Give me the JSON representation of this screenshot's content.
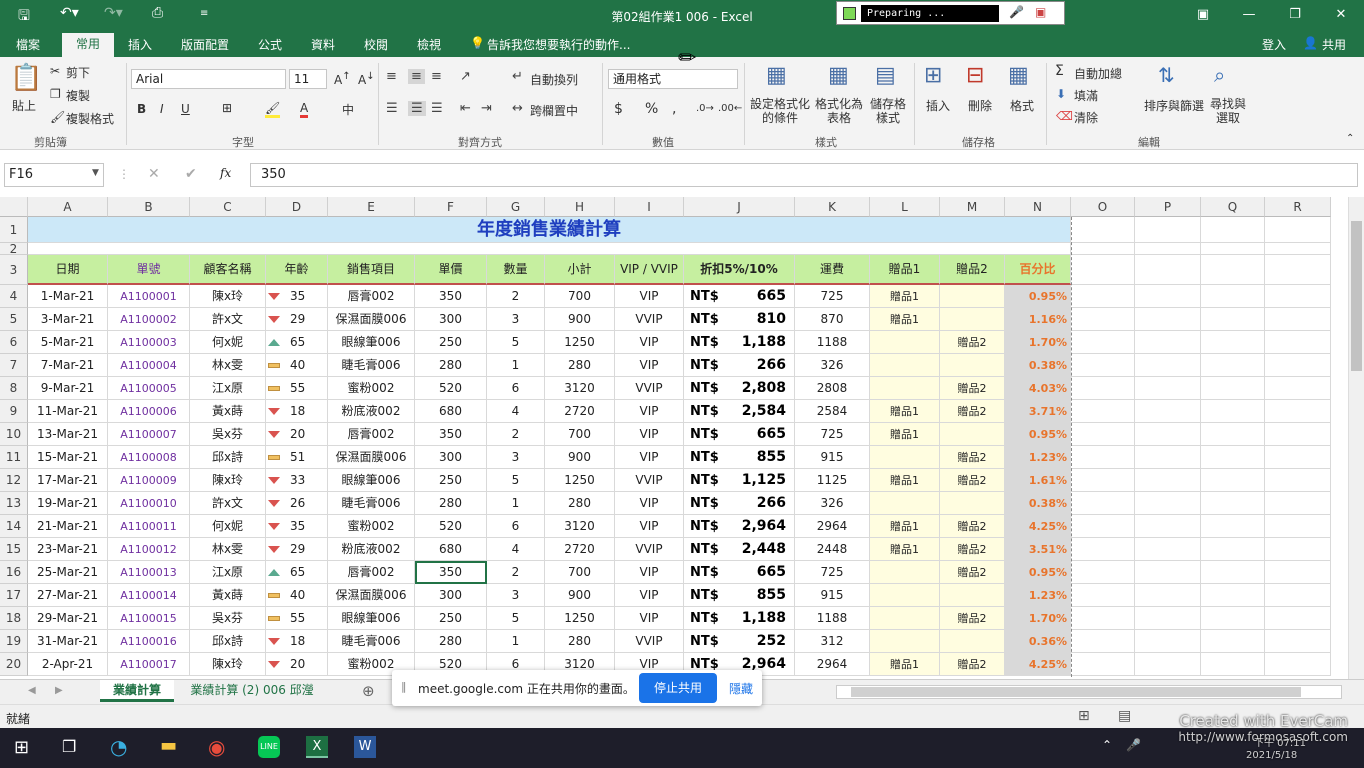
{
  "app": {
    "title": "第02組作業1 006 - Excel",
    "preparing": "Preparing ..."
  },
  "qat": {
    "save_icon": "save-icon",
    "undo_icon": "undo-icon",
    "redo_icon": "redo-icon",
    "preview_icon": "print-preview-icon"
  },
  "menu": {
    "tabs": [
      "檔案",
      "常用",
      "插入",
      "版面配置",
      "公式",
      "資料",
      "校閱",
      "檢視"
    ],
    "tell_me": "告訴我您想要執行的動作...",
    "signin": "登入",
    "share": "共用"
  },
  "ribbon": {
    "clipboard": {
      "paste": "貼上",
      "cut": "剪下",
      "copy": "複製",
      "format_painter": "複製格式",
      "label": "剪貼簿"
    },
    "font": {
      "name": "Arial",
      "size": "11",
      "label": "字型",
      "bold": "B",
      "italic": "I",
      "underline": "U"
    },
    "alignment": {
      "wrap": "自動換列",
      "merge": "跨欄置中",
      "label": "對齊方式"
    },
    "number": {
      "format": "通用格式",
      "currency": "$",
      "percent": "%",
      "comma": ",",
      "label": "數值"
    },
    "styles": {
      "conditional": "設定格式化的條件",
      "table": "格式化為表格",
      "cell_styles": "儲存格樣式",
      "label": "樣式"
    },
    "cells": {
      "insert": "插入",
      "delete": "刪除",
      "format": "格式",
      "label": "儲存格"
    },
    "editing": {
      "autosum": "自動加總",
      "fill": "填滿",
      "clear": "清除",
      "sort": "排序與篩選",
      "find": "尋找與選取",
      "label": "編輯"
    }
  },
  "formula": {
    "namebox": "F16",
    "fx": "fx",
    "value": "350"
  },
  "columns": [
    "A",
    "B",
    "C",
    "D",
    "E",
    "F",
    "G",
    "H",
    "I",
    "J",
    "K",
    "L",
    "M",
    "N",
    "O",
    "P",
    "Q",
    "R"
  ],
  "sheet": {
    "title": "年度銷售業績計算",
    "headers": [
      "日期",
      "單號",
      "顧客名稱",
      "年齡",
      "銷售項目",
      "單價",
      "數量",
      "小計",
      "VIP / VVIP",
      "折扣5%/10%",
      "運費",
      "贈品1",
      "贈品2",
      "百分比"
    ],
    "rows": [
      {
        "r": "4",
        "date": "1-Mar-21",
        "id": "A1100001",
        "name": "陳x玲",
        "trend": "down",
        "age": "35",
        "item": "唇膏002",
        "price": "350",
        "qty": "2",
        "sub": "700",
        "vip": "VIP",
        "cur": "NT$",
        "disc": "665",
        "ship": "725",
        "g1": "贈品1",
        "g2": "",
        "pct": "0.95%"
      },
      {
        "r": "5",
        "date": "3-Mar-21",
        "id": "A1100002",
        "name": "許x文",
        "trend": "down",
        "age": "29",
        "item": "保濕面膜006",
        "price": "300",
        "qty": "3",
        "sub": "900",
        "vip": "VVIP",
        "cur": "NT$",
        "disc": "810",
        "ship": "870",
        "g1": "贈品1",
        "g2": "",
        "pct": "1.16%"
      },
      {
        "r": "6",
        "date": "5-Mar-21",
        "id": "A1100003",
        "name": "何x妮",
        "trend": "up",
        "age": "65",
        "item": "眼線筆006",
        "price": "250",
        "qty": "5",
        "sub": "1250",
        "vip": "VIP",
        "cur": "NT$",
        "disc": "1,188",
        "ship": "1188",
        "g1": "",
        "g2": "贈品2",
        "pct": "1.70%"
      },
      {
        "r": "7",
        "date": "7-Mar-21",
        "id": "A1100004",
        "name": "林x雯",
        "trend": "flat",
        "age": "40",
        "item": "睫毛膏006",
        "price": "280",
        "qty": "1",
        "sub": "280",
        "vip": "VIP",
        "cur": "NT$",
        "disc": "266",
        "ship": "326",
        "g1": "",
        "g2": "",
        "pct": "0.38%"
      },
      {
        "r": "8",
        "date": "9-Mar-21",
        "id": "A1100005",
        "name": "江x原",
        "trend": "flat",
        "age": "55",
        "item": "蜜粉002",
        "price": "520",
        "qty": "6",
        "sub": "3120",
        "vip": "VVIP",
        "cur": "NT$",
        "disc": "2,808",
        "ship": "2808",
        "g1": "",
        "g2": "贈品2",
        "pct": "4.03%"
      },
      {
        "r": "9",
        "date": "11-Mar-21",
        "id": "A1100006",
        "name": "黃x蒔",
        "trend": "down",
        "age": "18",
        "item": "粉底液002",
        "price": "680",
        "qty": "4",
        "sub": "2720",
        "vip": "VIP",
        "cur": "NT$",
        "disc": "2,584",
        "ship": "2584",
        "g1": "贈品1",
        "g2": "贈品2",
        "pct": "3.71%"
      },
      {
        "r": "10",
        "date": "13-Mar-21",
        "id": "A1100007",
        "name": "吳x芬",
        "trend": "down",
        "age": "20",
        "item": "唇膏002",
        "price": "350",
        "qty": "2",
        "sub": "700",
        "vip": "VIP",
        "cur": "NT$",
        "disc": "665",
        "ship": "725",
        "g1": "贈品1",
        "g2": "",
        "pct": "0.95%"
      },
      {
        "r": "11",
        "date": "15-Mar-21",
        "id": "A1100008",
        "name": "邱x詩",
        "trend": "flat",
        "age": "51",
        "item": "保濕面膜006",
        "price": "300",
        "qty": "3",
        "sub": "900",
        "vip": "VIP",
        "cur": "NT$",
        "disc": "855",
        "ship": "915",
        "g1": "",
        "g2": "贈品2",
        "pct": "1.23%"
      },
      {
        "r": "12",
        "date": "17-Mar-21",
        "id": "A1100009",
        "name": "陳x玲",
        "trend": "down",
        "age": "33",
        "item": "眼線筆006",
        "price": "250",
        "qty": "5",
        "sub": "1250",
        "vip": "VVIP",
        "cur": "NT$",
        "disc": "1,125",
        "ship": "1125",
        "g1": "贈品1",
        "g2": "贈品2",
        "pct": "1.61%"
      },
      {
        "r": "13",
        "date": "19-Mar-21",
        "id": "A1100010",
        "name": "許x文",
        "trend": "down",
        "age": "26",
        "item": "睫毛膏006",
        "price": "280",
        "qty": "1",
        "sub": "280",
        "vip": "VIP",
        "cur": "NT$",
        "disc": "266",
        "ship": "326",
        "g1": "",
        "g2": "",
        "pct": "0.38%"
      },
      {
        "r": "14",
        "date": "21-Mar-21",
        "id": "A1100011",
        "name": "何x妮",
        "trend": "down",
        "age": "35",
        "item": "蜜粉002",
        "price": "520",
        "qty": "6",
        "sub": "3120",
        "vip": "VIP",
        "cur": "NT$",
        "disc": "2,964",
        "ship": "2964",
        "g1": "贈品1",
        "g2": "贈品2",
        "pct": "4.25%"
      },
      {
        "r": "15",
        "date": "23-Mar-21",
        "id": "A1100012",
        "name": "林x雯",
        "trend": "down",
        "age": "29",
        "item": "粉底液002",
        "price": "680",
        "qty": "4",
        "sub": "2720",
        "vip": "VVIP",
        "cur": "NT$",
        "disc": "2,448",
        "ship": "2448",
        "g1": "贈品1",
        "g2": "贈品2",
        "pct": "3.51%"
      },
      {
        "r": "16",
        "date": "25-Mar-21",
        "id": "A1100013",
        "name": "江x原",
        "trend": "up",
        "age": "65",
        "item": "唇膏002",
        "price": "350",
        "qty": "2",
        "sub": "700",
        "vip": "VIP",
        "cur": "NT$",
        "disc": "665",
        "ship": "725",
        "g1": "",
        "g2": "贈品2",
        "pct": "0.95%"
      },
      {
        "r": "17",
        "date": "27-Mar-21",
        "id": "A1100014",
        "name": "黃x蒔",
        "trend": "flat",
        "age": "40",
        "item": "保濕面膜006",
        "price": "300",
        "qty": "3",
        "sub": "900",
        "vip": "VIP",
        "cur": "NT$",
        "disc": "855",
        "ship": "915",
        "g1": "",
        "g2": "",
        "pct": "1.23%"
      },
      {
        "r": "18",
        "date": "29-Mar-21",
        "id": "A1100015",
        "name": "吳x芬",
        "trend": "flat",
        "age": "55",
        "item": "眼線筆006",
        "price": "250",
        "qty": "5",
        "sub": "1250",
        "vip": "VIP",
        "cur": "NT$",
        "disc": "1,188",
        "ship": "1188",
        "g1": "",
        "g2": "贈品2",
        "pct": "1.70%"
      },
      {
        "r": "19",
        "date": "31-Mar-21",
        "id": "A1100016",
        "name": "邱x詩",
        "trend": "down",
        "age": "18",
        "item": "睫毛膏006",
        "price": "280",
        "qty": "1",
        "sub": "280",
        "vip": "VVIP",
        "cur": "NT$",
        "disc": "252",
        "ship": "312",
        "g1": "",
        "g2": "",
        "pct": "0.36%"
      },
      {
        "r": "20",
        "date": "2-Apr-21",
        "id": "A1100017",
        "name": "陳x玲",
        "trend": "down",
        "age": "20",
        "item": "蜜粉002",
        "price": "520",
        "qty": "6",
        "sub": "3120",
        "vip": "VIP",
        "cur": "NT$",
        "disc": "2,964",
        "ship": "2964",
        "g1": "贈品1",
        "g2": "贈品2",
        "pct": "4.25%"
      }
    ]
  },
  "sheet_tabs": [
    "業績計算",
    "業績計算 (2) 006 邱瀅"
  ],
  "status": {
    "ready": "就緒"
  },
  "meet": {
    "text": "meet.google.com 正在共用你的畫面。",
    "stop": "停止共用",
    "hide": "隱藏"
  },
  "watermark": {
    "line1": "Created with EverCam",
    "line2": "http://www.formosasoft.com",
    "time": "下午 07:11",
    "date": "2021/5/18"
  },
  "colors": {
    "excel_green": "#217346",
    "header_bg": "#c6efa0",
    "title_bg": "#cce8f8",
    "yellow": "#fffde0",
    "pct_color": "#e8742c",
    "id_color": "#7030a0"
  }
}
